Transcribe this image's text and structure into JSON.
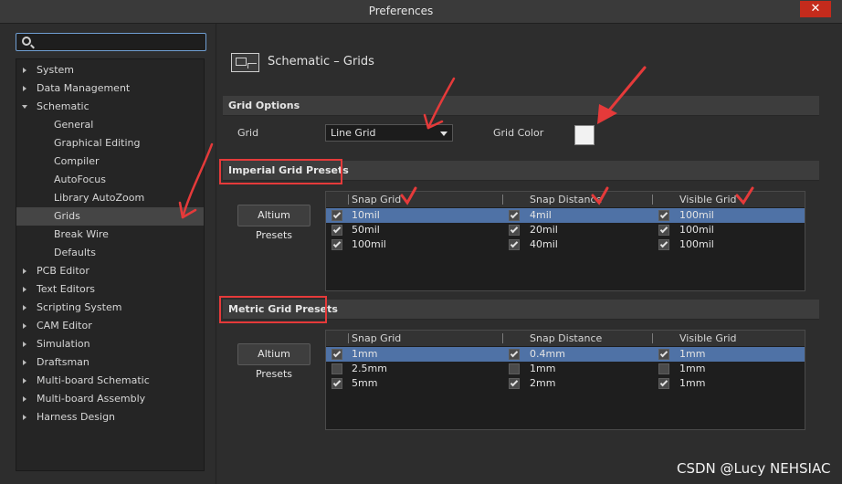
{
  "window": {
    "title": "Preferences",
    "close_glyph": "✕"
  },
  "search": {
    "placeholder": "",
    "value": ""
  },
  "sidebar": {
    "items": [
      {
        "label": "System",
        "level": 0,
        "expanded": false
      },
      {
        "label": "Data Management",
        "level": 0,
        "expanded": false
      },
      {
        "label": "Schematic",
        "level": 0,
        "expanded": true
      },
      {
        "label": "General",
        "level": 1
      },
      {
        "label": "Graphical Editing",
        "level": 1
      },
      {
        "label": "Compiler",
        "level": 1
      },
      {
        "label": "AutoFocus",
        "level": 1
      },
      {
        "label": "Library AutoZoom",
        "level": 1
      },
      {
        "label": "Grids",
        "level": 1,
        "selected": true
      },
      {
        "label": "Break Wire",
        "level": 1
      },
      {
        "label": "Defaults",
        "level": 1
      },
      {
        "label": "PCB Editor",
        "level": 0,
        "expanded": false
      },
      {
        "label": "Text Editors",
        "level": 0,
        "expanded": false
      },
      {
        "label": "Scripting System",
        "level": 0,
        "expanded": false
      },
      {
        "label": "CAM Editor",
        "level": 0,
        "expanded": false
      },
      {
        "label": "Simulation",
        "level": 0,
        "expanded": false
      },
      {
        "label": "Draftsman",
        "level": 0,
        "expanded": false
      },
      {
        "label": "Multi-board Schematic",
        "level": 0,
        "expanded": false
      },
      {
        "label": "Multi-board Assembly",
        "level": 0,
        "expanded": false
      },
      {
        "label": "Harness Design",
        "level": 0,
        "expanded": false
      }
    ]
  },
  "page": {
    "title": "Schematic – Grids",
    "icon": "schematic-sheet-icon"
  },
  "grid_options": {
    "section_title": "Grid Options",
    "grid_label": "Grid",
    "grid_value": "Line Grid",
    "grid_color_label": "Grid Color",
    "grid_color": "#f2f2f2"
  },
  "imperial": {
    "section_title": "Imperial Grid Presets",
    "button_label": "Altium Presets",
    "columns": [
      "Snap Grid",
      "Snap Distance",
      "Visible Grid"
    ],
    "rows": [
      {
        "snap_grid": "10mil",
        "snap_distance": "4mil",
        "visible_grid": "100mil",
        "checks": [
          true,
          true,
          true
        ],
        "selected": true
      },
      {
        "snap_grid": "50mil",
        "snap_distance": "20mil",
        "visible_grid": "100mil",
        "checks": [
          true,
          true,
          true
        ],
        "selected": false
      },
      {
        "snap_grid": "100mil",
        "snap_distance": "40mil",
        "visible_grid": "100mil",
        "checks": [
          true,
          true,
          true
        ],
        "selected": false
      }
    ]
  },
  "metric": {
    "section_title": "Metric Grid Presets",
    "button_label": "Altium Presets",
    "columns": [
      "Snap Grid",
      "Snap Distance",
      "Visible Grid"
    ],
    "rows": [
      {
        "snap_grid": "1mm",
        "snap_distance": "0.4mm",
        "visible_grid": "1mm",
        "checks": [
          true,
          true,
          true
        ],
        "selected": true
      },
      {
        "snap_grid": "2.5mm",
        "snap_distance": "1mm",
        "visible_grid": "1mm",
        "checks": [
          false,
          false,
          false
        ],
        "selected": false
      },
      {
        "snap_grid": "5mm",
        "snap_distance": "2mm",
        "visible_grid": "1mm",
        "checks": [
          true,
          true,
          true
        ],
        "selected": false
      }
    ]
  },
  "watermark": "CSDN @Lucy NEHSIAC",
  "colors": {
    "annotation_red": "#e53a3a",
    "selection_blue": "#4f72a6",
    "search_border": "#6f9ed2",
    "close_red": "#c42b1c"
  }
}
